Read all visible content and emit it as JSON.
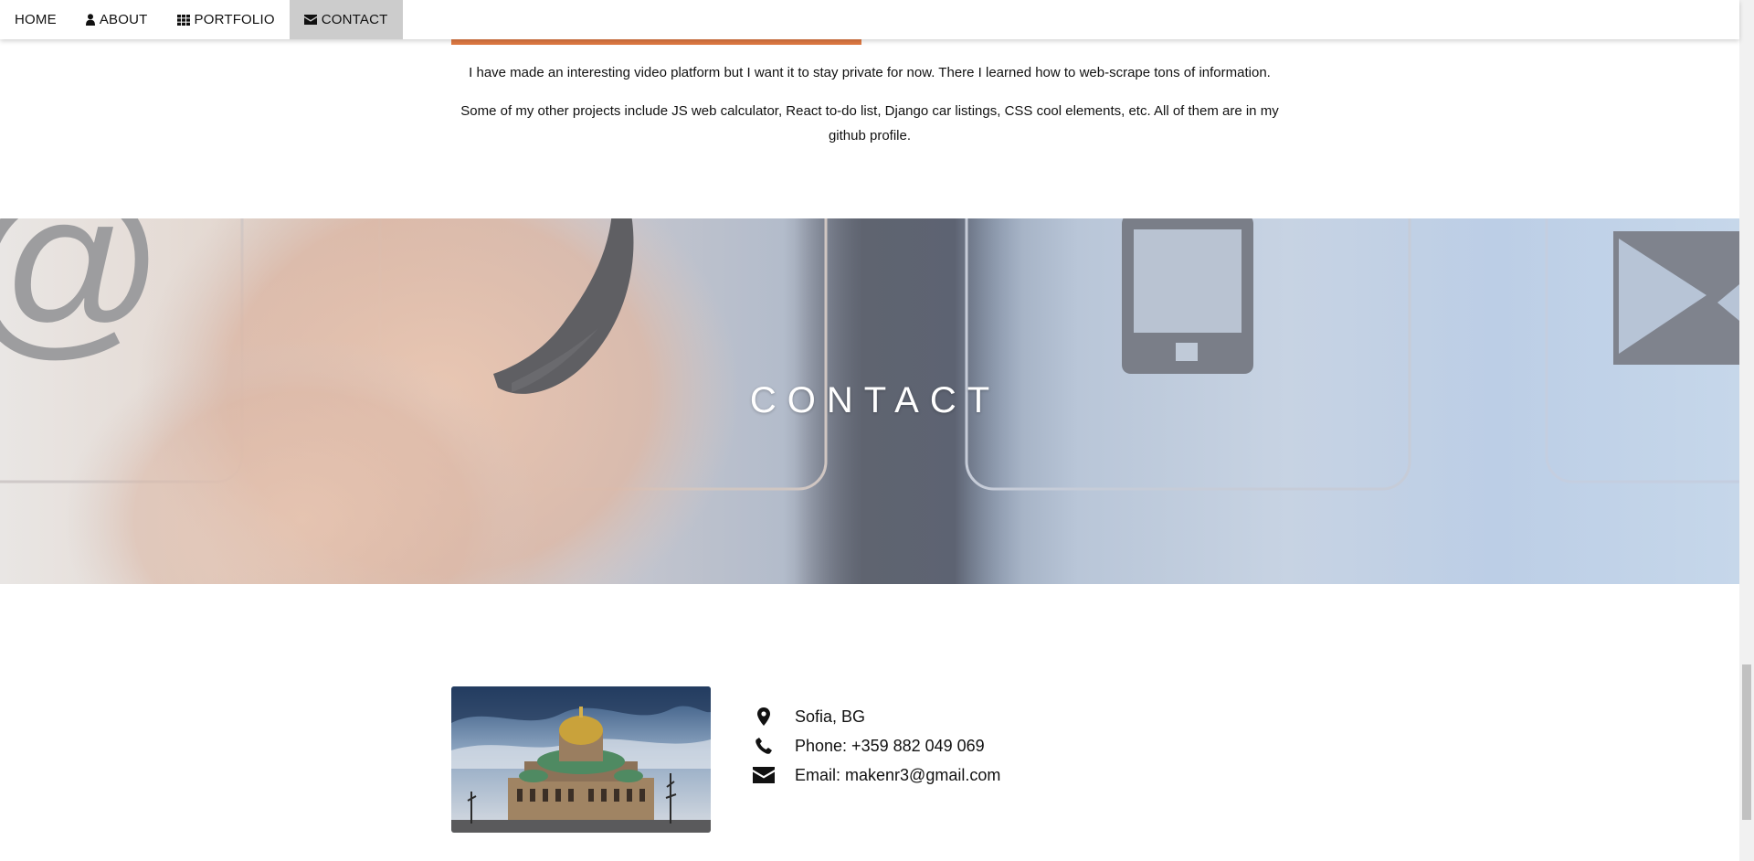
{
  "nav": {
    "items": [
      {
        "label": "HOME",
        "icon": "",
        "active": false
      },
      {
        "label": "ABOUT",
        "icon": "user-icon",
        "active": false
      },
      {
        "label": "PORTFOLIO",
        "icon": "grid-icon",
        "active": false
      },
      {
        "label": "CONTACT",
        "icon": "envelope-icon",
        "active": true
      }
    ]
  },
  "portfolio": {
    "paragraph1": "I have made an interesting video platform but I want it to stay private for now. There I learned how to web-scrape tons of information.",
    "paragraph2": "Some of my other projects include JS web calculator, React to-do list, Django car listings, CSS cool elements, etc. All of them are in my github profile."
  },
  "contact": {
    "title": "CONTACT",
    "location": "Sofia, BG",
    "phone": "Phone: +359 882 049 069",
    "email": "Email: makenr3@gmail.com"
  },
  "colors": {
    "accent_orange": "#e07a43",
    "active_nav_bg": "#cccccc"
  }
}
